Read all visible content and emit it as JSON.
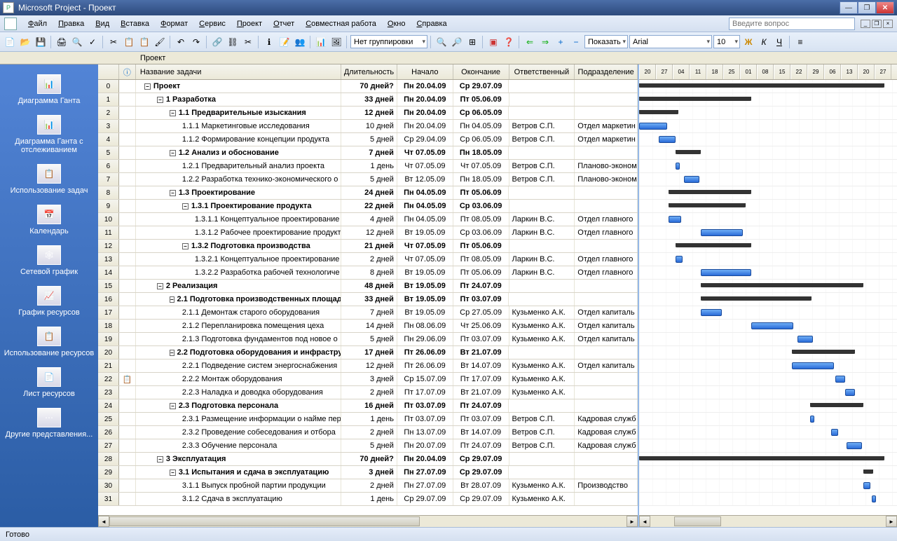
{
  "title": "Microsoft Project - Проект",
  "menu": [
    "Файл",
    "Правка",
    "Вид",
    "Вставка",
    "Формат",
    "Сервис",
    "Проект",
    "Отчет",
    "Совместная работа",
    "Окно",
    "Справка"
  ],
  "help_placeholder": "Введите вопрос",
  "toolbar2": {
    "group": "Нет группировки",
    "show": "Показать",
    "font": "Arial",
    "size": "10"
  },
  "doc_label": "Проект",
  "columns": {
    "info": "",
    "task": "Название задачи",
    "dur": "Длительность",
    "start": "Начало",
    "end": "Окончание",
    "resp": "Ответственный",
    "dept": "Подразделение"
  },
  "sidebar": [
    {
      "label": "Диаграмма Ганта"
    },
    {
      "label": "Диаграмма Ганта с отслеживанием"
    },
    {
      "label": "Использование задач"
    },
    {
      "label": "Календарь"
    },
    {
      "label": "Сетевой график"
    },
    {
      "label": "График ресурсов"
    },
    {
      "label": "Использование ресурсов"
    },
    {
      "label": "Лист ресурсов"
    },
    {
      "label": "Другие представления..."
    }
  ],
  "gantt_dates": [
    "20",
    "27",
    "04",
    "11",
    "18",
    "25",
    "01",
    "08",
    "15",
    "22",
    "29",
    "06",
    "13",
    "20",
    "27"
  ],
  "tasks": [
    {
      "n": 0,
      "lvl": 0,
      "sum": true,
      "name": "Проект",
      "dur": "70 дней?",
      "start": "Пн 20.04.09",
      "end": "Ср 29.07.09",
      "resp": "",
      "dept": "",
      "gx": 0,
      "gw": 350
    },
    {
      "n": 1,
      "lvl": 1,
      "sum": true,
      "name": "1 Разработка",
      "dur": "33 дней",
      "start": "Пн 20.04.09",
      "end": "Пт 05.06.09",
      "resp": "",
      "dept": "",
      "gx": 0,
      "gw": 160
    },
    {
      "n": 2,
      "lvl": 2,
      "sum": true,
      "name": "1.1 Предварительные изыскания",
      "dur": "12 дней",
      "start": "Пн 20.04.09",
      "end": "Ср 06.05.09",
      "resp": "",
      "dept": "",
      "gx": 0,
      "gw": 56
    },
    {
      "n": 3,
      "lvl": 3,
      "sum": false,
      "name": "1.1.1 Маркетинговые исследования",
      "dur": "10 дней",
      "start": "Пн 20.04.09",
      "end": "Пн 04.05.09",
      "resp": "Ветров С.П.",
      "dept": "Отдел маркетин",
      "gx": 0,
      "gw": 40
    },
    {
      "n": 4,
      "lvl": 3,
      "sum": false,
      "name": "1.1.2 Формирование концепции продукта",
      "dur": "5 дней",
      "start": "Ср 29.04.09",
      "end": "Ср 06.05.09",
      "resp": "Ветров С.П.",
      "dept": "Отдел маркетин",
      "gx": 28,
      "gw": 24
    },
    {
      "n": 5,
      "lvl": 2,
      "sum": true,
      "name": "1.2 Анализ и обоснование",
      "dur": "7 дней",
      "start": "Чт 07.05.09",
      "end": "Пн 18.05.09",
      "resp": "",
      "dept": "",
      "gx": 52,
      "gw": 36
    },
    {
      "n": 6,
      "lvl": 3,
      "sum": false,
      "name": "1.2.1 Предварительный анализ проекта",
      "dur": "1 день",
      "start": "Чт 07.05.09",
      "end": "Чт 07.05.09",
      "resp": "Ветров С.П.",
      "dept": "Планово-эконом",
      "gx": 52,
      "gw": 6
    },
    {
      "n": 7,
      "lvl": 3,
      "sum": false,
      "name": "1.2.2 Разработка технико-экономического о",
      "dur": "5 дней",
      "start": "Вт 12.05.09",
      "end": "Пн 18.05.09",
      "resp": "Ветров С.П.",
      "dept": "Планово-эконом",
      "gx": 64,
      "gw": 22
    },
    {
      "n": 8,
      "lvl": 2,
      "sum": true,
      "name": "1.3 Проектирование",
      "dur": "24 дней",
      "start": "Пн 04.05.09",
      "end": "Пт 05.06.09",
      "resp": "",
      "dept": "",
      "gx": 42,
      "gw": 118
    },
    {
      "n": 9,
      "lvl": 3,
      "sum": true,
      "name": "1.3.1 Проектирование продукта",
      "dur": "22 дней",
      "start": "Пн 04.05.09",
      "end": "Ср 03.06.09",
      "resp": "",
      "dept": "",
      "gx": 42,
      "gw": 110
    },
    {
      "n": 10,
      "lvl": 4,
      "sum": false,
      "name": "1.3.1.1 Концептуальное проектирование",
      "dur": "4 дней",
      "start": "Пн 04.05.09",
      "end": "Пт 08.05.09",
      "resp": "Ларкин В.С.",
      "dept": "Отдел главного",
      "gx": 42,
      "gw": 18
    },
    {
      "n": 11,
      "lvl": 4,
      "sum": false,
      "name": "1.3.1.2 Рабочее проектирование продукт",
      "dur": "12 дней",
      "start": "Вт 19.05.09",
      "end": "Ср 03.06.09",
      "resp": "Ларкин В.С.",
      "dept": "Отдел главного",
      "gx": 88,
      "gw": 60
    },
    {
      "n": 12,
      "lvl": 3,
      "sum": true,
      "name": "1.3.2 Подготовка производства",
      "dur": "21 дней",
      "start": "Чт 07.05.09",
      "end": "Пт 05.06.09",
      "resp": "",
      "dept": "",
      "gx": 52,
      "gw": 108
    },
    {
      "n": 13,
      "lvl": 4,
      "sum": false,
      "name": "1.3.2.1 Концептуальное проектирование",
      "dur": "2 дней",
      "start": "Чт 07.05.09",
      "end": "Пт 08.05.09",
      "resp": "Ларкин В.С.",
      "dept": "Отдел главного",
      "gx": 52,
      "gw": 10
    },
    {
      "n": 14,
      "lvl": 4,
      "sum": false,
      "name": "1.3.2.2 Разработка рабочей технологиче",
      "dur": "8 дней",
      "start": "Вт 19.05.09",
      "end": "Пт 05.06.09",
      "resp": "Ларкин В.С.",
      "dept": "Отдел главного",
      "gx": 88,
      "gw": 72
    },
    {
      "n": 15,
      "lvl": 1,
      "sum": true,
      "name": "2 Реализация",
      "dur": "48 дней",
      "start": "Вт 19.05.09",
      "end": "Пт 24.07.09",
      "resp": "",
      "dept": "",
      "gx": 88,
      "gw": 232
    },
    {
      "n": 16,
      "lvl": 2,
      "sum": true,
      "name": "2.1 Подготовка производственных площад",
      "dur": "33 дней",
      "start": "Вт 19.05.09",
      "end": "Пт 03.07.09",
      "resp": "",
      "dept": "",
      "gx": 88,
      "gw": 158
    },
    {
      "n": 17,
      "lvl": 3,
      "sum": false,
      "name": "2.1.1 Демонтаж старого оборудования",
      "dur": "7 дней",
      "start": "Вт 19.05.09",
      "end": "Ср 27.05.09",
      "resp": "Кузьменко А.К.",
      "dept": "Отдел капиталь",
      "gx": 88,
      "gw": 30
    },
    {
      "n": 18,
      "lvl": 3,
      "sum": false,
      "name": "2.1.2 Перепланировка помещения цеха",
      "dur": "14 дней",
      "start": "Пн 08.06.09",
      "end": "Чт 25.06.09",
      "resp": "Кузьменко А.К.",
      "dept": "Отдел капиталь",
      "gx": 160,
      "gw": 60
    },
    {
      "n": 19,
      "lvl": 3,
      "sum": false,
      "name": "2.1.3 Подготовка фундаментов под новое о",
      "dur": "5 дней",
      "start": "Пн 29.06.09",
      "end": "Пт 03.07.09",
      "resp": "Кузьменко А.К.",
      "dept": "Отдел капиталь",
      "gx": 226,
      "gw": 22
    },
    {
      "n": 20,
      "lvl": 2,
      "sum": true,
      "name": "2.2 Подготовка оборудования и инфрастру",
      "dur": "17 дней",
      "start": "Пт 26.06.09",
      "end": "Вт 21.07.09",
      "resp": "",
      "dept": "",
      "gx": 218,
      "gw": 90
    },
    {
      "n": 21,
      "lvl": 3,
      "sum": false,
      "name": "2.2.1 Подведение систем энергоснабжения",
      "dur": "12 дней",
      "start": "Пт 26.06.09",
      "end": "Вт 14.07.09",
      "resp": "Кузьменко А.К.",
      "dept": "Отдел капиталь",
      "gx": 218,
      "gw": 60
    },
    {
      "n": 22,
      "lvl": 3,
      "sum": false,
      "name": "2.2.2 Монтаж оборудования",
      "dur": "3 дней",
      "start": "Ср 15.07.09",
      "end": "Пт 17.07.09",
      "resp": "Кузьменко А.К.",
      "dept": "",
      "gx": 280,
      "gw": 14,
      "info": "📋"
    },
    {
      "n": 23,
      "lvl": 3,
      "sum": false,
      "name": "2.2.3 Наладка и доводка оборудования",
      "dur": "2 дней",
      "start": "Пт 17.07.09",
      "end": "Вт 21.07.09",
      "resp": "Кузьменко А.К.",
      "dept": "",
      "gx": 294,
      "gw": 14
    },
    {
      "n": 24,
      "lvl": 2,
      "sum": true,
      "name": "2.3 Подготовка персонала",
      "dur": "16 дней",
      "start": "Пт 03.07.09",
      "end": "Пт 24.07.09",
      "resp": "",
      "dept": "",
      "gx": 244,
      "gw": 76
    },
    {
      "n": 25,
      "lvl": 3,
      "sum": false,
      "name": "2.3.1 Размещение информации о найме пер",
      "dur": "1 день",
      "start": "Пт 03.07.09",
      "end": "Пт 03.07.09",
      "resp": "Ветров С.П.",
      "dept": "Кадровая служб",
      "gx": 244,
      "gw": 6
    },
    {
      "n": 26,
      "lvl": 3,
      "sum": false,
      "name": "2.3.2 Проведение собеседования и отбора",
      "dur": "2 дней",
      "start": "Пн 13.07.09",
      "end": "Вт 14.07.09",
      "resp": "Ветров С.П.",
      "dept": "Кадровая служб",
      "gx": 274,
      "gw": 10
    },
    {
      "n": 27,
      "lvl": 3,
      "sum": false,
      "name": "2.3.3 Обучение персонала",
      "dur": "5 дней",
      "start": "Пн 20.07.09",
      "end": "Пт 24.07.09",
      "resp": "Ветров С.П.",
      "dept": "Кадровая служб",
      "gx": 296,
      "gw": 22
    },
    {
      "n": 28,
      "lvl": 1,
      "sum": true,
      "name": "3 Эксплуатация",
      "dur": "70 дней?",
      "start": "Пн 20.04.09",
      "end": "Ср 29.07.09",
      "resp": "",
      "dept": "",
      "gx": 0,
      "gw": 350
    },
    {
      "n": 29,
      "lvl": 2,
      "sum": true,
      "name": "3.1 Испытания и сдача в эксплуатацию",
      "dur": "3 дней",
      "start": "Пн 27.07.09",
      "end": "Ср 29.07.09",
      "resp": "",
      "dept": "",
      "gx": 320,
      "gw": 14
    },
    {
      "n": 30,
      "lvl": 3,
      "sum": false,
      "name": "3.1.1 Выпуск пробной партии продукции",
      "dur": "2 дней",
      "start": "Пн 27.07.09",
      "end": "Вт 28.07.09",
      "resp": "Кузьменко А.К.",
      "dept": "Производство",
      "gx": 320,
      "gw": 10
    },
    {
      "n": 31,
      "lvl": 3,
      "sum": false,
      "name": "3.1.2 Сдача в эксплуатацию",
      "dur": "1 день",
      "start": "Ср 29.07.09",
      "end": "Ср 29.07.09",
      "resp": "Кузьменко А.К.",
      "dept": "",
      "gx": 332,
      "gw": 6
    }
  ],
  "status": "Готово"
}
